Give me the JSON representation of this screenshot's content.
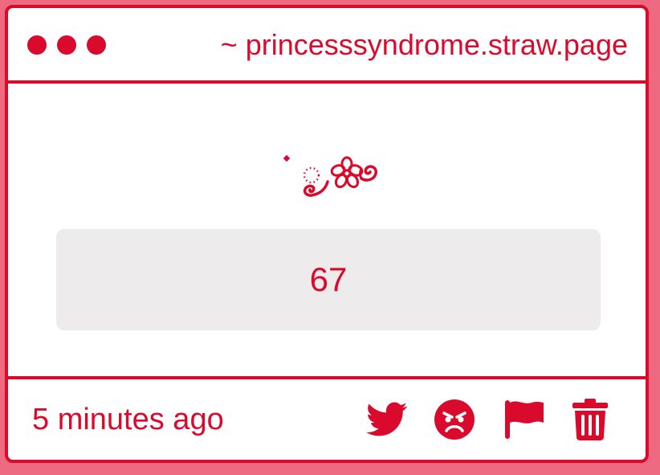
{
  "window": {
    "url_label": "~ princesssyndrome.straw.page",
    "traffic_lights": [
      "close-dot",
      "minimize-dot",
      "maximize-dot"
    ]
  },
  "message": {
    "decoration": "flower-swirl-emoji",
    "value": "67"
  },
  "footer": {
    "timestamp": "5 minutes ago",
    "actions": [
      "twitter-icon",
      "angry-face-icon",
      "flag-icon",
      "trash-icon"
    ]
  },
  "colors": {
    "accent": "#d90a2c",
    "page_background": "#ee6a80",
    "card_background": "#ffffff",
    "value_box": "#edebeb"
  }
}
